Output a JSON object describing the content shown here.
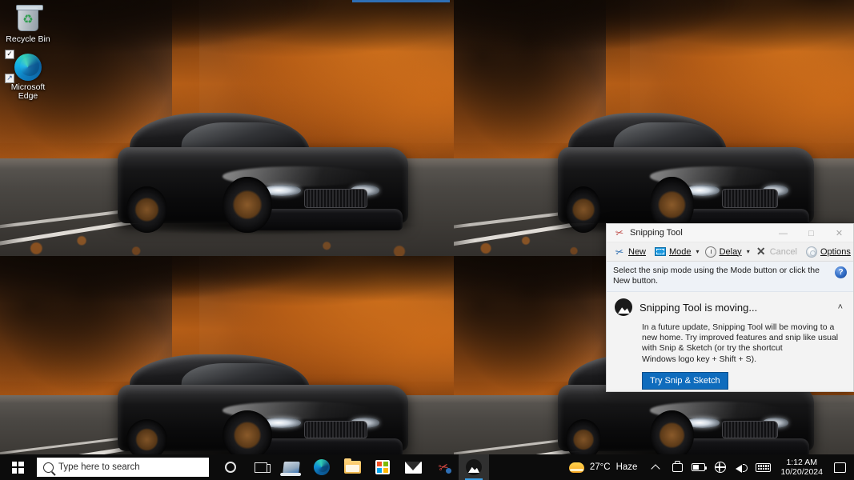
{
  "desktop": {
    "wallpaper_description": "Black BMW sports car parked on an asphalt road with autumn orange foliage, tiled 2x2",
    "icons": [
      {
        "label": "Recycle Bin",
        "icon": "recycle-bin-icon"
      },
      {
        "label": "Microsoft\nEdge",
        "label_line1": "Microsoft",
        "label_line2": "Edge",
        "icon": "microsoft-edge-icon"
      }
    ]
  },
  "snipping_tool": {
    "title": "Snipping Tool",
    "title_icon": "snipping-tool-scissors-icon",
    "window_buttons": {
      "minimize": "—",
      "maximize": "□",
      "close": "✕"
    },
    "toolbar": {
      "new_label": "New",
      "new_icon": "scissors-icon",
      "mode_label": "Mode",
      "mode_icon": "rectangle-snip-icon",
      "mode_caret": "▾",
      "delay_label": "Delay",
      "delay_icon": "clock-icon",
      "delay_caret": "▾",
      "cancel_label": "Cancel",
      "cancel_icon": "close-x-icon",
      "cancel_disabled": true,
      "options_label": "Options",
      "options_icon": "gear-icon"
    },
    "hint": {
      "text": "Select the snip mode using the Mode button or click the New button.",
      "help_icon": "help-question-icon",
      "help_glyph": "?"
    },
    "notice": {
      "icon": "photos-mountain-icon",
      "title": "Snipping Tool is moving...",
      "collapse_caret": "˄",
      "body_line1": "In a future update, Snipping Tool will be moving to a new home. Try improved features and snip like usual with Snip & Sketch (or try the shortcut",
      "body_line2": "Windows  logo  key  +  Shift  +  S).",
      "button_label": "Try Snip & Sketch",
      "button_color": "#0f6cbd"
    }
  },
  "taskbar": {
    "start_icon": "windows-start-icon",
    "search": {
      "placeholder": "Type here to search",
      "icon": "search-icon"
    },
    "items": [
      {
        "name": "cortana-icon",
        "label": "Cortana"
      },
      {
        "name": "task-view-icon",
        "label": "Task View"
      },
      {
        "name": "quick-assist-icon",
        "label": "Quick Assist"
      },
      {
        "name": "microsoft-edge-icon",
        "label": "Microsoft Edge"
      },
      {
        "name": "file-explorer-icon",
        "label": "File Explorer"
      },
      {
        "name": "microsoft-store-icon",
        "label": "Microsoft Store"
      },
      {
        "name": "mail-icon",
        "label": "Mail"
      },
      {
        "name": "snipping-tool-icon",
        "label": "Snipping Tool"
      },
      {
        "name": "photos-icon",
        "label": "Photos",
        "active": true
      }
    ],
    "tray": {
      "weather_icon": "sun-icon",
      "temperature": "27°C",
      "condition": "Haze",
      "show_hidden_icons": "˄",
      "onedrive_icon": "onedrive-icon",
      "battery_icon": "battery-icon",
      "network_icon": "network-globe-icon",
      "volume_icon": "volume-icon",
      "keyboard_icon": "keyboard-icon",
      "time": "1:12 AM",
      "date": "10/20/2024",
      "action_center_icon": "action-center-icon"
    }
  }
}
